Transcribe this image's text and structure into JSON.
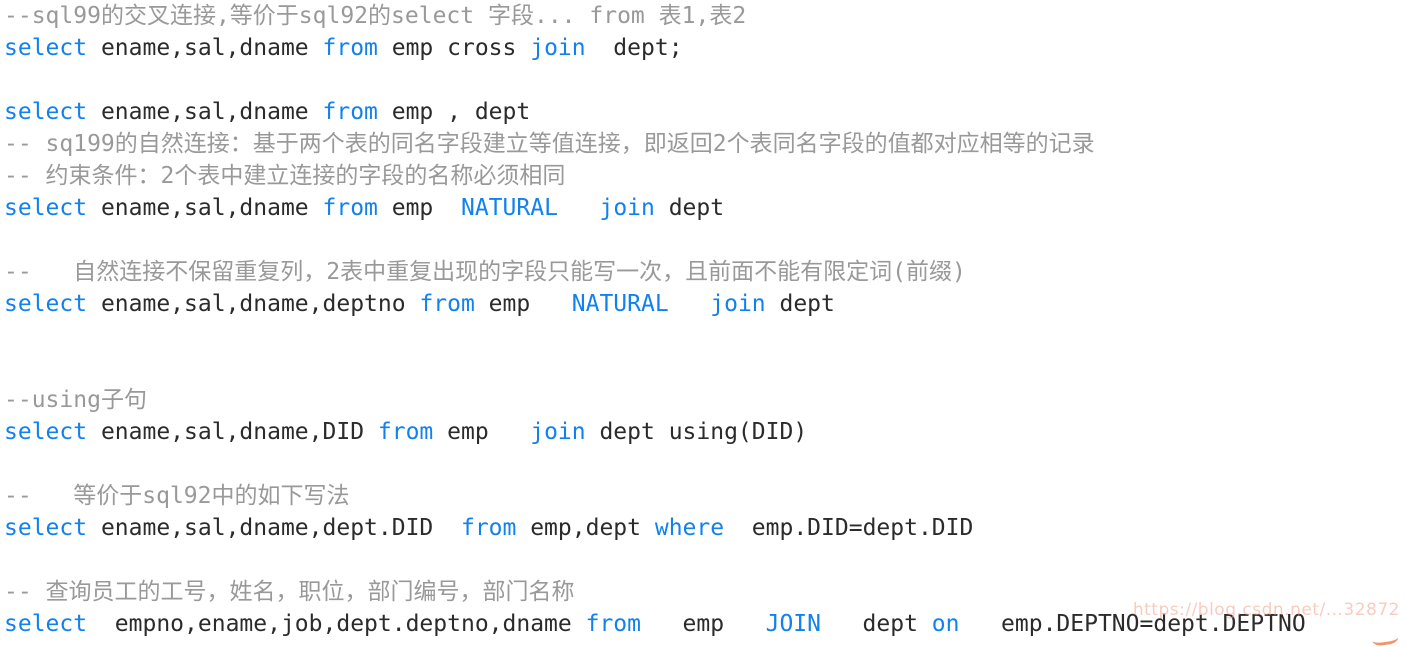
{
  "editor": {
    "language": "sql",
    "theme_background": "#ffffff",
    "colors": {
      "keyword": "#1281f0",
      "comment": "#999999",
      "plain": "#2b2b2b",
      "watermark": "#f4a48a"
    },
    "watermark_text": "https://blog.csdn.net/...32872"
  },
  "lines": [
    {
      "index": 1,
      "type": "comment",
      "tokens": [
        {
          "kind": "comment",
          "text": "--sql99的交叉连接,等价于sql92的select 字段... from 表1,表2"
        }
      ]
    },
    {
      "index": 2,
      "type": "code",
      "tokens": [
        {
          "kind": "keyword",
          "text": "select"
        },
        {
          "kind": "plain",
          "text": " ename,sal,dname "
        },
        {
          "kind": "keyword",
          "text": "from"
        },
        {
          "kind": "plain",
          "text": " emp cross "
        },
        {
          "kind": "keyword",
          "text": "join"
        },
        {
          "kind": "plain",
          "text": "  dept;"
        }
      ]
    },
    {
      "index": 3,
      "type": "blank",
      "tokens": []
    },
    {
      "index": 4,
      "type": "code",
      "tokens": [
        {
          "kind": "keyword",
          "text": "select"
        },
        {
          "kind": "plain",
          "text": " ename,sal,dname "
        },
        {
          "kind": "keyword",
          "text": "from"
        },
        {
          "kind": "plain",
          "text": " emp , dept"
        }
      ]
    },
    {
      "index": 5,
      "type": "comment",
      "tokens": [
        {
          "kind": "comment",
          "text": "-- sq199的自然连接：基于两个表的同名字段建立等值连接，即返回2个表同名字段的值都对应相等的记录"
        }
      ]
    },
    {
      "index": 6,
      "type": "comment",
      "tokens": [
        {
          "kind": "comment",
          "text": "-- 约束条件：2个表中建立连接的字段的名称必须相同"
        }
      ]
    },
    {
      "index": 7,
      "type": "code",
      "tokens": [
        {
          "kind": "keyword",
          "text": "select"
        },
        {
          "kind": "plain",
          "text": " ename,sal,dname "
        },
        {
          "kind": "keyword",
          "text": "from"
        },
        {
          "kind": "plain",
          "text": " emp  "
        },
        {
          "kind": "keyword",
          "text": "NATURAL"
        },
        {
          "kind": "plain",
          "text": "   "
        },
        {
          "kind": "keyword",
          "text": "join"
        },
        {
          "kind": "plain",
          "text": " dept"
        }
      ]
    },
    {
      "index": 8,
      "type": "blank",
      "tokens": []
    },
    {
      "index": 9,
      "type": "comment",
      "tokens": [
        {
          "kind": "comment",
          "text": "--   自然连接不保留重复列，2表中重复出现的字段只能写一次，且前面不能有限定词(前缀)"
        }
      ]
    },
    {
      "index": 10,
      "type": "code",
      "tokens": [
        {
          "kind": "keyword",
          "text": "select"
        },
        {
          "kind": "plain",
          "text": " ename,sal,dname,deptno "
        },
        {
          "kind": "keyword",
          "text": "from"
        },
        {
          "kind": "plain",
          "text": " emp   "
        },
        {
          "kind": "keyword",
          "text": "NATURAL"
        },
        {
          "kind": "plain",
          "text": "   "
        },
        {
          "kind": "keyword",
          "text": "join"
        },
        {
          "kind": "plain",
          "text": " dept"
        }
      ]
    },
    {
      "index": 11,
      "type": "blank",
      "tokens": []
    },
    {
      "index": 12,
      "type": "blank",
      "tokens": []
    },
    {
      "index": 13,
      "type": "comment",
      "tokens": [
        {
          "kind": "comment",
          "text": "--using子句"
        }
      ]
    },
    {
      "index": 14,
      "type": "code",
      "tokens": [
        {
          "kind": "keyword",
          "text": "select"
        },
        {
          "kind": "plain",
          "text": " ename,sal,dname,DID "
        },
        {
          "kind": "keyword",
          "text": "from"
        },
        {
          "kind": "plain",
          "text": " emp   "
        },
        {
          "kind": "keyword",
          "text": "join"
        },
        {
          "kind": "plain",
          "text": " dept using(DID)"
        }
      ]
    },
    {
      "index": 15,
      "type": "blank",
      "tokens": []
    },
    {
      "index": 16,
      "type": "comment",
      "tokens": [
        {
          "kind": "comment",
          "text": "--   等价于sql92中的如下写法"
        }
      ]
    },
    {
      "index": 17,
      "type": "code",
      "tokens": [
        {
          "kind": "keyword",
          "text": "select"
        },
        {
          "kind": "plain",
          "text": " ename,sal,dname,dept.DID  "
        },
        {
          "kind": "keyword",
          "text": "from"
        },
        {
          "kind": "plain",
          "text": " emp,dept "
        },
        {
          "kind": "keyword",
          "text": "where"
        },
        {
          "kind": "plain",
          "text": "  emp.DID=dept.DID"
        }
      ]
    },
    {
      "index": 18,
      "type": "blank",
      "tokens": []
    },
    {
      "index": 19,
      "type": "comment",
      "tokens": [
        {
          "kind": "comment",
          "text": "-- 查询员工的工号，姓名，职位，部门编号，部门名称"
        }
      ]
    },
    {
      "index": 20,
      "type": "code",
      "tokens": [
        {
          "kind": "keyword",
          "text": "select"
        },
        {
          "kind": "plain",
          "text": "  empno,ename,job,dept.deptno,dname "
        },
        {
          "kind": "keyword",
          "text": "from"
        },
        {
          "kind": "plain",
          "text": "   emp   "
        },
        {
          "kind": "keyword",
          "text": "JOIN"
        },
        {
          "kind": "plain",
          "text": "   dept "
        },
        {
          "kind": "keyword",
          "text": "on"
        },
        {
          "kind": "plain",
          "text": "   emp.DEPTNO=dept.DEPTNO"
        }
      ]
    }
  ]
}
